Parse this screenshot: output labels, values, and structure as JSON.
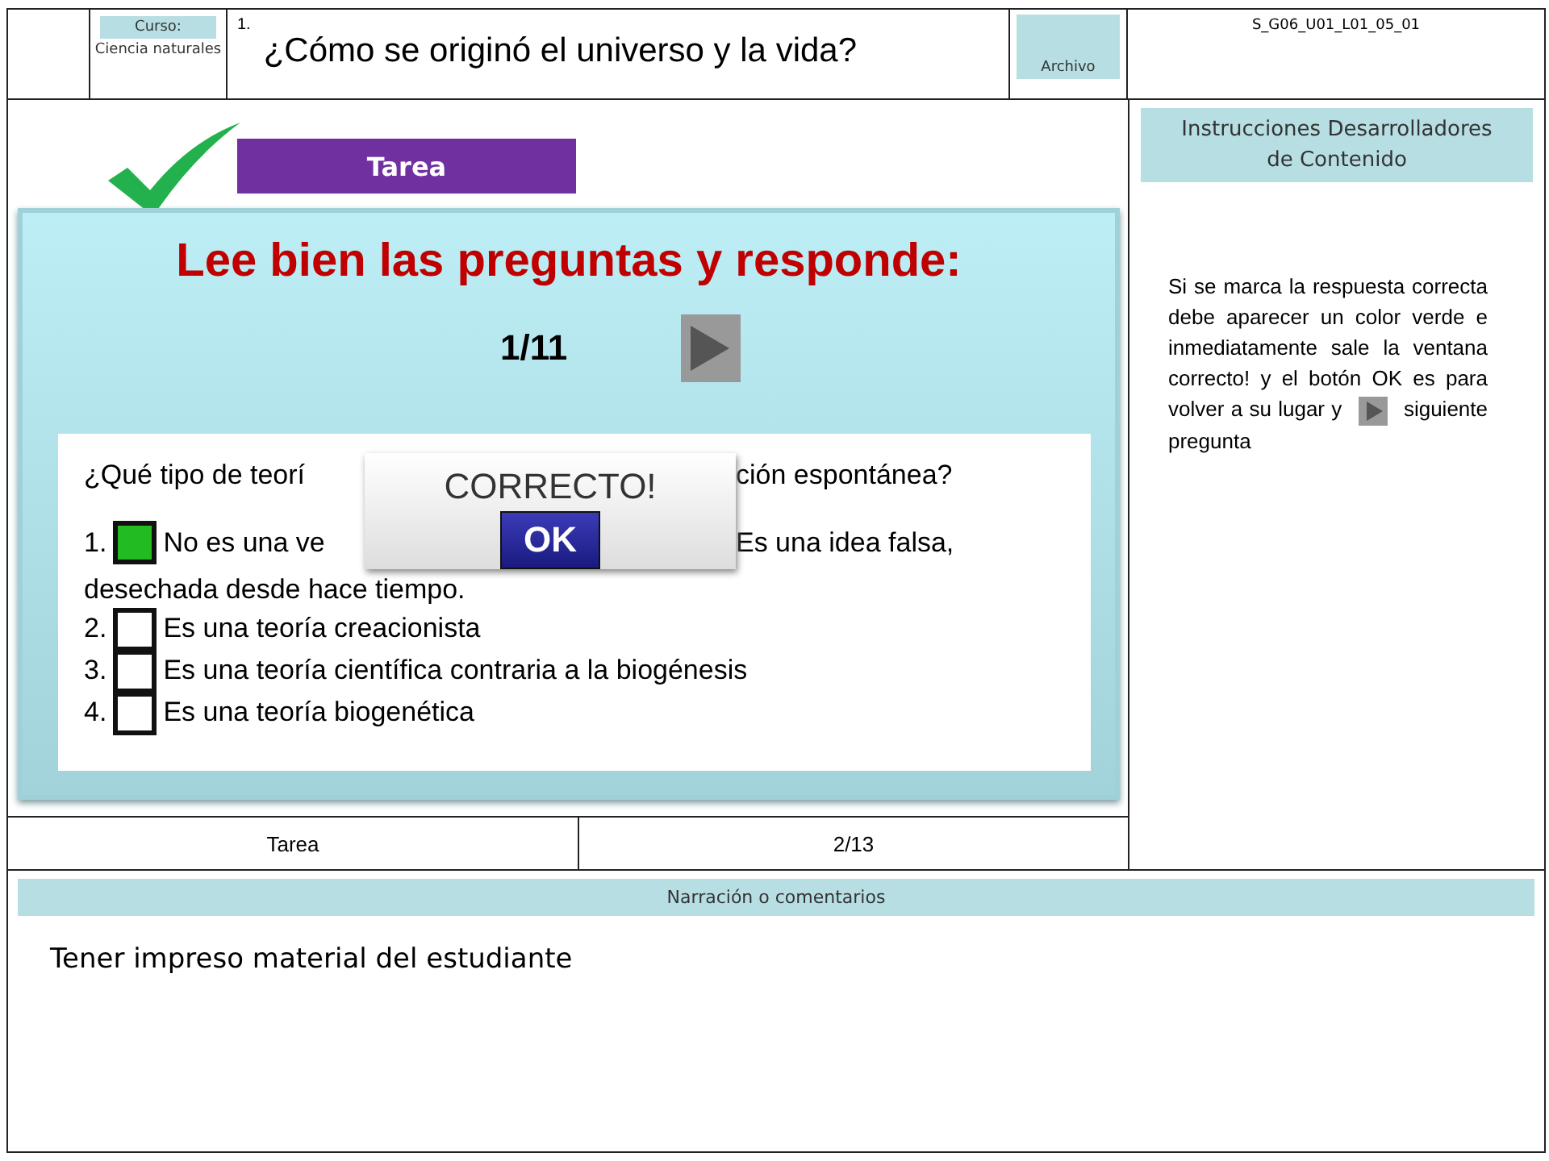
{
  "header": {
    "course_label": "Curso:",
    "course_name": "Ciencia naturales",
    "number": "1.",
    "title": "¿Cómo se originó el universo y la vida?",
    "file_label": "Archivo",
    "code": "S_G06_U01_L01_05_01"
  },
  "task_banner": "Tarea",
  "activity": {
    "heading": "Lee bien las preguntas y responde:",
    "counter": "1/11",
    "question": {
      "before": "¿Qué tipo de teorí",
      "after": "ción espontánea?"
    },
    "options": [
      {
        "number": "1.",
        "checked": true,
        "text": "No es una ve",
        "text_after": "Es una idea falsa,",
        "continuation": "desechada desde hace tiempo."
      },
      {
        "number": "2.",
        "checked": false,
        "text": "Es una teoría creacionista"
      },
      {
        "number": "3.",
        "checked": false,
        "text": "Es una teoría científica contraria a la biogénesis"
      },
      {
        "number": "4.",
        "checked": false,
        "text": "Es una teoría biogenética"
      }
    ],
    "popup": {
      "message": "CORRECTO!",
      "button": "OK"
    }
  },
  "footer_row": [
    "Tarea",
    "2/13"
  ],
  "instructions": {
    "title": "Instrucciones Desarrolladores de Contenido",
    "text_before": "Si se marca la respuesta correcta debe aparecer un color verde e inmediatamente sale la ventana correcto! y el botón OK es para volver a su lugar y",
    "text_after": "siguiente pregunta"
  },
  "narration": {
    "label": "Narración o comentarios",
    "text": "Tener impreso material del estudiante"
  }
}
